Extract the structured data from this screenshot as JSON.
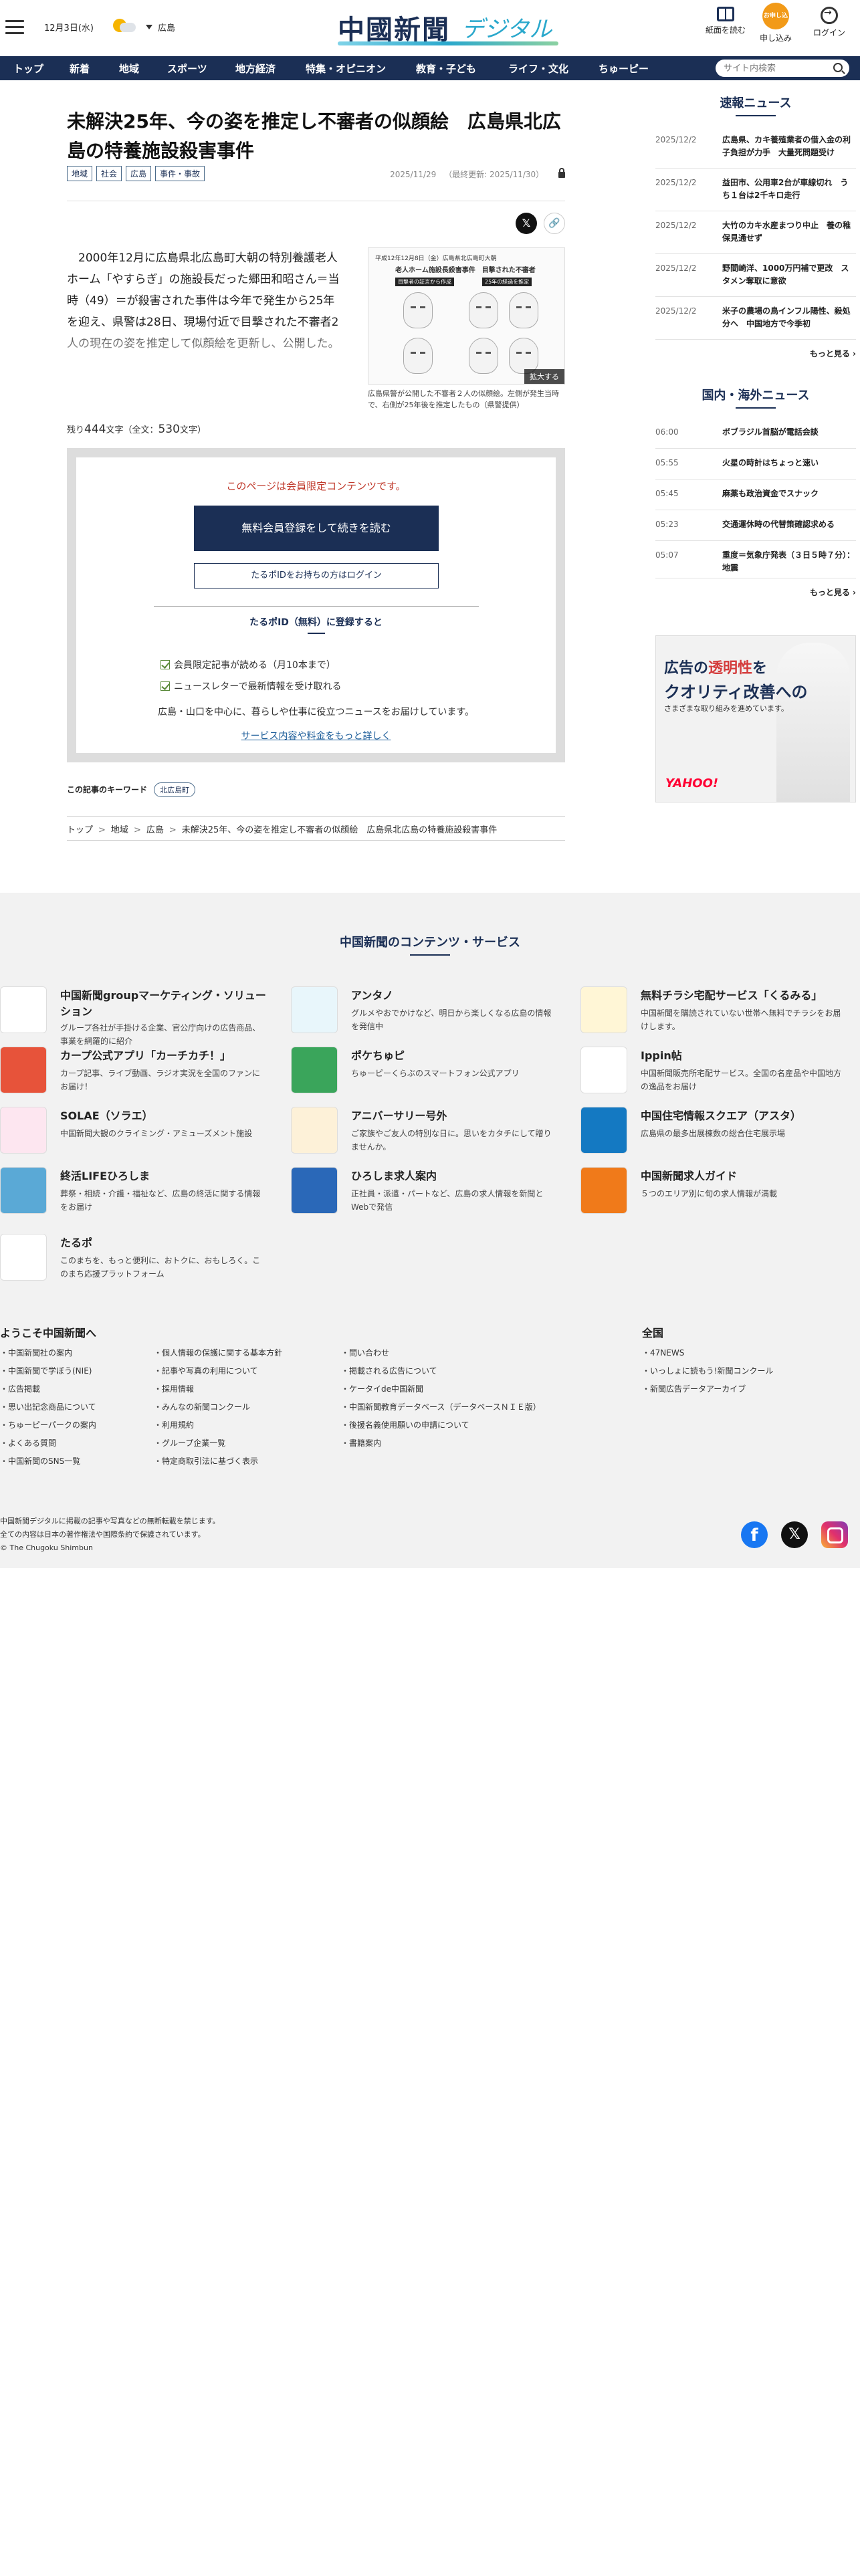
{
  "header": {
    "date": "12月3日(水)",
    "area": "広島",
    "logo_main": "中國新聞",
    "logo_sub": "デジタル",
    "btn_paper": "紙面を読む",
    "btn_apply": "申し込み",
    "btn_login": "ログイン",
    "apply_badge": "お申し込み"
  },
  "nav": {
    "items": [
      "トップ",
      "新着",
      "地域",
      "スポーツ",
      "地方経済",
      "特集・オピニオン",
      "教育・子ども",
      "ライフ・文化",
      "ちゅーピー"
    ],
    "search_placeholder": "サイト内検索"
  },
  "article": {
    "title": "未解決25年、今の姿を推定し不審者の似顔絵　広島県北広島の特養施設殺害事件",
    "tags": [
      "地域",
      "社会",
      "広島",
      "事件・事故"
    ],
    "date": "2025/11/29",
    "updated": "（最終更新: 2025/11/30）",
    "lead": "2000年12月に広島県北広島町大朝の特別養護老人ホーム「やすらぎ」の施設長だった郷田和昭さん＝当時（49）＝が殺害された事件は今年で発生から25年を迎え、県警は28日、現場付近で目撃された不審者2人の現在の姿を推定して似顔絵を更新し、公開した。",
    "photo_header": "平成12年12月8日（金）広島県北広島町大朝",
    "photo_title": "老人ホーム施設長殺害事件　目撃された不審者",
    "photo_label_1": "目撃者の証言から作成",
    "photo_label_2": "25年の経過を推定",
    "enlarge": "拡大する",
    "photo_caption": "広島県警が公開した不審者２人の似顔絵。左側が発生当時で、右側が25年後を推定したもの（県警提供）",
    "remaining_prefix": "残り",
    "remaining_count": "444",
    "remaining_mid": "文字（全文：",
    "total_count": "530",
    "remaining_suffix": "文字）"
  },
  "paywall": {
    "notice": "このページは会員限定コンテンツです。",
    "register": "無料会員登録をして続きを読む",
    "login": "たるポIDをお持ちの方はログイン",
    "heading": "たるポID（無料）に登録すると",
    "benefits": [
      "会員限定記事が読める（月10本まで）",
      "ニュースレターで最新情報を受け取れる"
    ],
    "desc": "広島・山口を中心に、暮らしや仕事に役立つニュースをお届けしています。",
    "more": "サービス内容や料金をもっと詳しく"
  },
  "keywords": {
    "label": "この記事のキーワード",
    "items": [
      "北広島町"
    ]
  },
  "breadcrumb": [
    "トップ",
    "地域",
    "広島",
    "未解決25年、今の姿を推定し不審者の似顔絵　広島県北広島の特養施設殺害事件"
  ],
  "sidebar": {
    "breaking_title": "速報ニュース",
    "breaking": [
      {
        "date": "2025/12/2",
        "text": "広島県、カキ養殖業者の借入金の利子負担が力手　大量死問題受け"
      },
      {
        "date": "2025/12/2",
        "text": "益田市、公用車2台が車線切れ　うち１台は2千キロ走行"
      },
      {
        "date": "2025/12/2",
        "text": "大竹のカキ水産まつり中止　養の稚保見通せず"
      },
      {
        "date": "2025/12/2",
        "text": "野間崎洋、1000万円補で更改　スタメン奪取に意欲"
      },
      {
        "date": "2025/12/2",
        "text": "米子の農場の鳥インフル陽性、殺処分へ　中国地方で今季初"
      }
    ],
    "more1": "もっと見る ›",
    "world_title": "国内・海外ニュース",
    "world": [
      {
        "date": "06:00",
        "text": "ボブラジル首脳が電話会談"
      },
      {
        "date": "05:55",
        "text": "火星の時計はちょっと速い"
      },
      {
        "date": "05:45",
        "text": "麻薬も政治資金でスナック"
      },
      {
        "date": "05:23",
        "text": "交通運休時の代替策確認求める"
      },
      {
        "date": "05:07",
        "text": "重度＝気象庁発表（３日５時７分）：地震"
      }
    ],
    "more2": "もっと見る ›"
  },
  "ad": {
    "line1_a": "広告の",
    "line1_b": "透明性",
    "line1_c": "を",
    "line2": "クオリティ改善への",
    "line3": "さまざまな取り組みを進めています。",
    "logo": "YAHOO!"
  },
  "footer": {
    "title": "中国新聞のコンテンツ・サービス",
    "services": [
      {
        "name": "中国新聞groupマーケティング・ソリューション",
        "desc": "グループ各社が手掛ける企業、官公庁向けの広告商品、事業を網羅的に紹介",
        "color": "#ffffff",
        "icon": "marketing-icon"
      },
      {
        "name": "アンタノ",
        "desc": "グルメやおでかけなど、明日から楽しくなる広島の情報を発信中",
        "color": "#e8f6fb",
        "icon": "antano-icon"
      },
      {
        "name": "無料チラシ宅配サービス「くるみる」",
        "desc": "中国新聞を購読されていない世帯へ無料でチラシをお届けします。",
        "color": "#fff6d6",
        "icon": "kurumiru-icon"
      },
      {
        "name": "カープ公式アプリ「カーチカチ！」",
        "desc": "カープ記事、ライブ動画、ラジオ実況を全国のファンにお届け！",
        "color": "#e7533a",
        "icon": "carp-icon"
      },
      {
        "name": "ポケちゅピ",
        "desc": "ちゅーピーくらぶのスマートフォン公式アプリ",
        "color": "#3aa55b",
        "icon": "pokechupi-icon"
      },
      {
        "name": "Ippin帖",
        "desc": "中国新聞販売所宅配サービス。全国の名産品や中国地方の逸品をお届け",
        "color": "#ffffff",
        "icon": "ippin-icon"
      },
      {
        "name": "SOLAE（ソラエ）",
        "desc": "中国新聞大観のクライミング・アミューズメント施設",
        "color": "#fde6f0",
        "icon": "solae-icon"
      },
      {
        "name": "アニバーサリー号外",
        "desc": "ご家族やご友人の特別な日に。思いをカタチにして贈りませんか。",
        "color": "#fdf1d8",
        "icon": "anniversary-icon"
      },
      {
        "name": "中国住宅情報スクエア（アスタ）",
        "desc": "広島県の最多出展棟数の総合住宅展示場",
        "color": "#1479c2",
        "icon": "asta-icon"
      },
      {
        "name": "終活LIFEひろしま",
        "desc": "葬祭・相続・介護・福祉など、広島の終活に関する情報をお届け",
        "color": "#5aa9d6",
        "icon": "shukatsu-icon"
      },
      {
        "name": "ひろしま求人案内",
        "desc": "正社員・派遣・パートなど、広島の求人情報を新聞とWebで発信",
        "color": "#2a68b8",
        "icon": "kyujin-icon"
      },
      {
        "name": "中国新聞求人ガイド",
        "desc": "５つのエリア別に旬の求人情報が満載",
        "color": "#f07a1a",
        "icon": "guide-icon"
      },
      {
        "name": "たるポ",
        "desc": "このまちを、もっと便利に、おトクに、おもしろく。このまち応援プラットフォーム",
        "color": "#ffffff",
        "icon": "tarupo-icon"
      }
    ],
    "links_title": "ようこそ中国新聞へ",
    "links_col1": [
      "・中国新聞社の案内",
      "・中国新聞で学ぼう(NIE)",
      "・広告掲載",
      "・思い出記念商品について",
      "・ちゅーピーパークの案内",
      "・よくある質問",
      "・中国新聞のSNS一覧"
    ],
    "links_col2": [
      "・個人情報の保護に関する基本方針",
      "・記事や写真の利用について",
      "・採用情報",
      "・みんなの新聞コンクール",
      "・利用規約",
      "・グループ企業一覧",
      "・特定商取引法に基づく表示"
    ],
    "links_col3": [
      "・問い合わせ",
      "・掲載される広告について",
      "・ケータイde中国新聞",
      "・中国新聞教育データベース（データベースＮＩＥ版）",
      "・後援名義使用願いの申請について",
      "・書籍案内"
    ],
    "nationwide_title": "全国",
    "links_col4": [
      "・47NEWS",
      "・いっしょに読もう!新聞コンクール",
      "・新聞広告データアーカイブ"
    ],
    "copy1": "中国新聞デジタルに掲載の記事や写真などの無断転載を禁じます。",
    "copy2": "全ての内容は日本の著作権法や国際条約で保護されています。",
    "copy3": "© The Chugoku Shimbun"
  }
}
